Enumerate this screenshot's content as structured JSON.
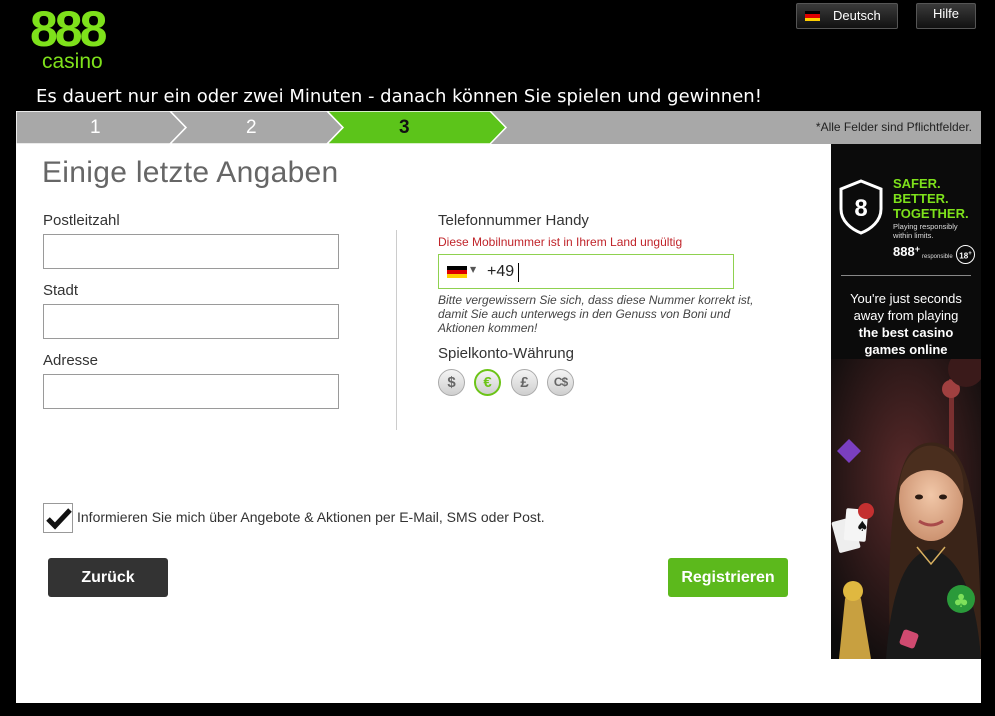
{
  "header": {
    "logo_top": "888",
    "logo_bottom": "casino",
    "language_label": "Deutsch",
    "help_label": "Hilfe",
    "tagline": "Es dauert nur ein oder zwei Minuten - danach können Sie spielen und gewinnen!"
  },
  "steps": {
    "items": [
      {
        "label": "1",
        "state": "done"
      },
      {
        "label": "2",
        "state": "done"
      },
      {
        "label": "3",
        "state": "active"
      }
    ],
    "required_note": "*Alle Felder sind Pflichtfelder."
  },
  "form": {
    "title": "Einige letzte Angaben",
    "postal_code_label": "Postleitzahl",
    "postal_code_value": "",
    "city_label": "Stadt",
    "city_value": "",
    "address_label": "Adresse",
    "address_value": "",
    "phone_label": "Telefonnummer Handy",
    "phone_error": "Diese Mobilnummer ist in Ihrem Land ungültig",
    "phone_prefix": "+49",
    "phone_hint": "Bitte vergewissern Sie sich, dass diese Nummer korrekt ist, damit Sie auch unterwegs in den Genuss von Boni und Aktionen kommen!",
    "currency_label": "Spielkonto-Währung",
    "currencies": [
      {
        "symbol": "$",
        "selected": false
      },
      {
        "symbol": "€",
        "selected": true
      },
      {
        "symbol": "£",
        "selected": false
      },
      {
        "symbol": "C$",
        "selected": false
      }
    ],
    "newsletter_label": "Informieren Sie mich über Angebote & Aktionen per E-Mail, SMS oder Post.",
    "newsletter_checked": true,
    "back_label": "Zurück",
    "register_label": "Registrieren"
  },
  "ad": {
    "headline_1": "SAFER.",
    "headline_2": "BETTER.",
    "headline_3": "TOGETHER.",
    "small_1": "Playing responsibly",
    "small_2": "within limits.",
    "brand": "888",
    "brand_plus": "+",
    "brand_sub": "responsible",
    "age_badge": "18",
    "age_plus": "+",
    "copy_1": "You're just seconds",
    "copy_2": "away from playing",
    "copy_3": "the best casino",
    "copy_4": "games online"
  },
  "colors": {
    "brand_green": "#7ee11b",
    "button_green": "#5cb91c",
    "error_red": "#c0242a",
    "step_bar_grey": "#a8a8a8"
  }
}
